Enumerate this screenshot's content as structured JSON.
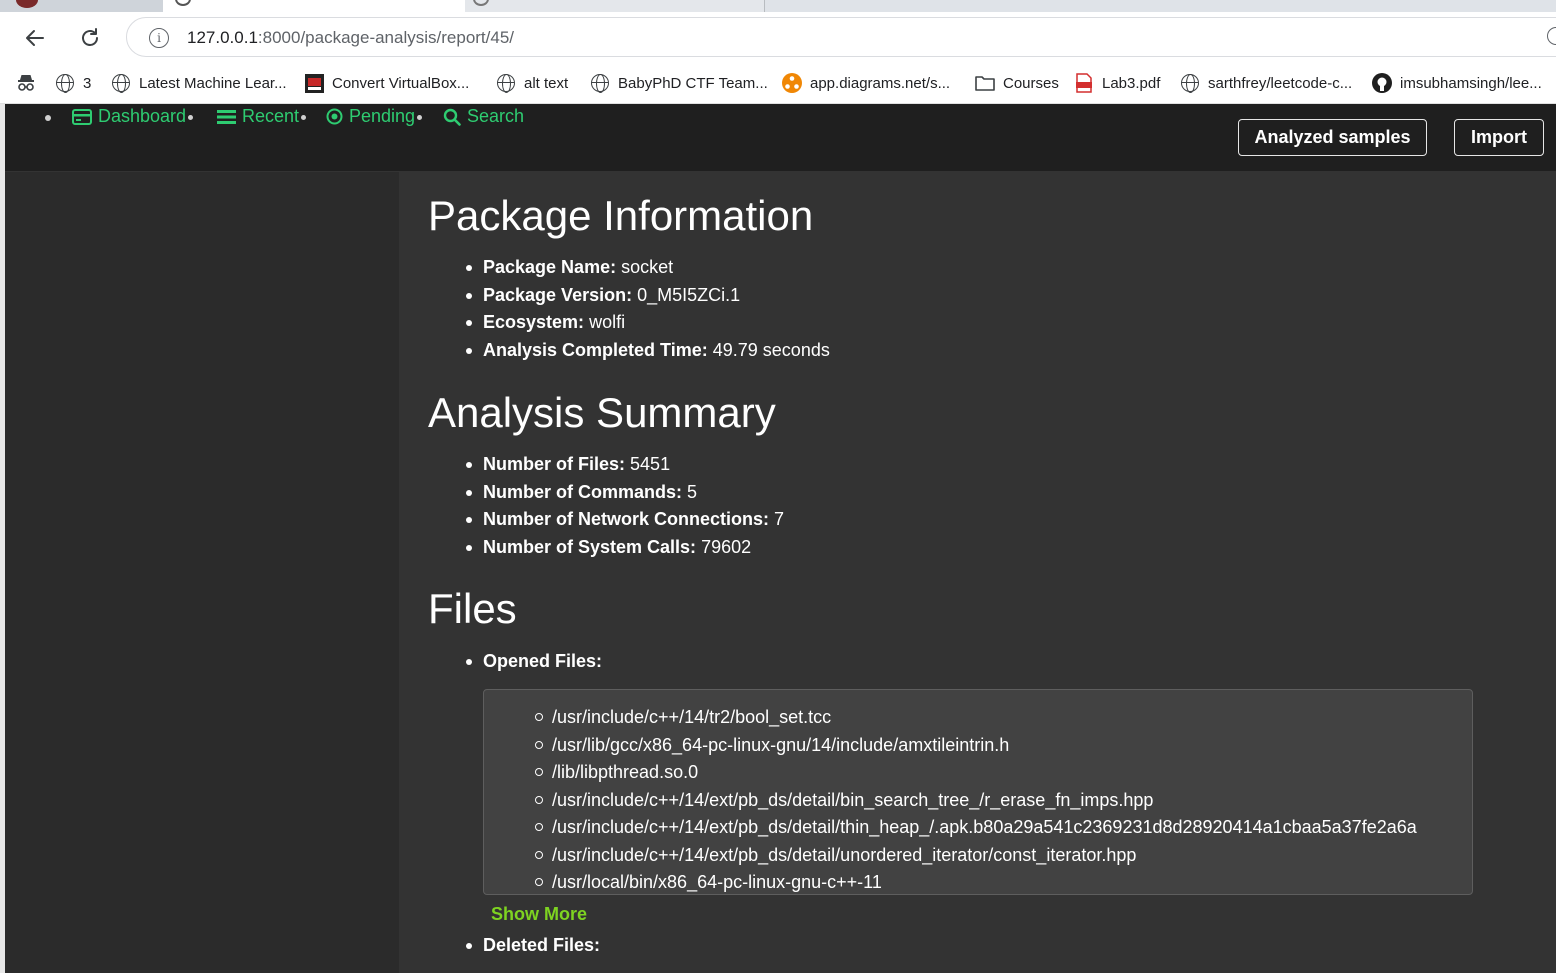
{
  "browser": {
    "url_host": "127.0.0.1",
    "url_rest": ":8000/package-analysis/report/45/",
    "bookmarks": [
      {
        "label": "3",
        "icon": "globe-icon"
      },
      {
        "label": "Latest Machine Lear...",
        "icon": "globe-icon"
      },
      {
        "label": "Convert VirtualBox...",
        "icon": "app-icon"
      },
      {
        "label": "alt text",
        "icon": "globe-icon"
      },
      {
        "label": "BabyPhD CTF Team...",
        "icon": "globe-icon"
      },
      {
        "label": "app.diagrams.net/s...",
        "icon": "diagrams-icon"
      },
      {
        "label": "Courses",
        "icon": "folder-icon"
      },
      {
        "label": "Lab3.pdf",
        "icon": "pdf-icon"
      },
      {
        "label": "sarthfrey/leetcode-c...",
        "icon": "globe-icon"
      },
      {
        "label": "imsubhamsingh/lee...",
        "icon": "github-icon"
      }
    ]
  },
  "navbar": {
    "links": [
      {
        "label": "Dashboard",
        "icon": "dashboard-icon"
      },
      {
        "label": "Recent",
        "icon": "list-icon"
      },
      {
        "label": "Pending",
        "icon": "pending-icon"
      },
      {
        "label": "Search",
        "icon": "search-icon"
      }
    ],
    "buttons": {
      "analyzed_samples": "Analyzed samples",
      "import": "Import"
    }
  },
  "package_info": {
    "heading": "Package Information",
    "items": [
      {
        "label": "Package Name:",
        "value": "socket"
      },
      {
        "label": "Package Version:",
        "value": "0_M5I5ZCi.1"
      },
      {
        "label": "Ecosystem:",
        "value": "wolfi"
      },
      {
        "label": "Analysis Completed Time:",
        "value": "49.79 seconds"
      }
    ]
  },
  "analysis_summary": {
    "heading": "Analysis Summary",
    "items": [
      {
        "label": "Number of Files:",
        "value": "5451"
      },
      {
        "label": "Number of Commands:",
        "value": "5"
      },
      {
        "label": "Number of Network Connections:",
        "value": "7"
      },
      {
        "label": "Number of System Calls:",
        "value": "79602"
      }
    ]
  },
  "files": {
    "heading": "Files",
    "opened_label": "Opened Files:",
    "opened_files": [
      "/usr/include/c++/14/tr2/bool_set.tcc",
      "/usr/lib/gcc/x86_64-pc-linux-gnu/14/include/amxtileintrin.h",
      "/lib/libpthread.so.0",
      "/usr/include/c++/14/ext/pb_ds/detail/bin_search_tree_/r_erase_fn_imps.hpp",
      "/usr/include/c++/14/ext/pb_ds/detail/thin_heap_/.apk.b80a29a541c2369231d8d28920414a1cbaa5a37fe2a6a",
      "/usr/include/c++/14/ext/pb_ds/detail/unordered_iterator/const_iterator.hpp",
      "/usr/local/bin/x86_64-pc-linux-gnu-c++-11"
    ],
    "show_more": "Show More",
    "deleted_label": "Deleted Files:"
  }
}
